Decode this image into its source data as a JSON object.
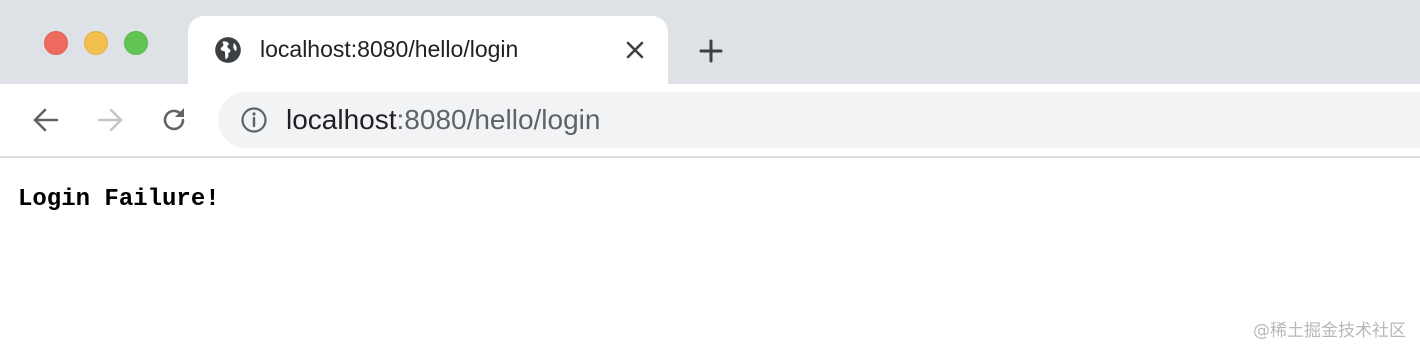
{
  "window": {
    "traffic_lights": [
      "close",
      "minimize",
      "zoom"
    ]
  },
  "tab": {
    "title": "localhost:8080/hello/login",
    "icon": "globe-icon"
  },
  "toolbar": {
    "back_icon": "arrow-left-icon",
    "forward_icon": "arrow-right-icon",
    "reload_icon": "reload-icon"
  },
  "address_bar": {
    "host": "localhost",
    "rest": ":8080/hello/login",
    "icon": "info-icon"
  },
  "page": {
    "message": "Login Failure!"
  },
  "watermark": {
    "text": "@稀土掘金技术社区"
  },
  "colors": {
    "titlebar": "#dee1e6",
    "omnibox": "#f1f3f4",
    "traffic_close": "#ee6a5e",
    "traffic_min": "#f5bf4f",
    "traffic_max": "#61c554"
  }
}
